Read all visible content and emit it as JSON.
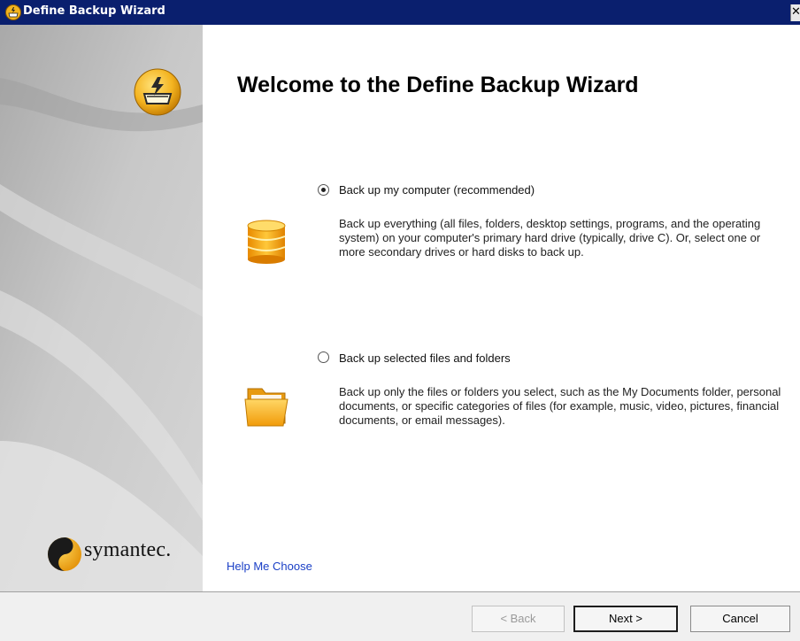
{
  "window": {
    "title": "Define Backup Wizard",
    "close_glyph": "✕",
    "icon": "backup-wizard-icon"
  },
  "banner": {
    "icon": "backup-wizard-icon",
    "brand": "symantec."
  },
  "main": {
    "heading": "Welcome to the Define Backup Wizard",
    "options": [
      {
        "label": "Back up my computer (recommended)",
        "selected": true,
        "icon": "hard-drive-icon",
        "description": "Back up everything (all files, folders, desktop settings, programs, and the operating system) on your computer's primary hard drive (typically, drive C). Or, select one or more secondary drives or hard disks to back up."
      },
      {
        "label": "Back up selected files and folders",
        "selected": false,
        "icon": "folder-icon",
        "description": "Back up only the files or folders you select, such as the My Documents folder, personal documents, or specific categories of files (for example, music, video, pictures, financial documents, or email messages)."
      }
    ],
    "help_link": "Help Me Choose"
  },
  "buttons": {
    "back": "< Back",
    "next": "Next >",
    "cancel": "Cancel"
  },
  "colors": {
    "title_bar": "#0a1f6e",
    "accent_orange": "#f3a81c",
    "link": "#1a3fc6"
  }
}
